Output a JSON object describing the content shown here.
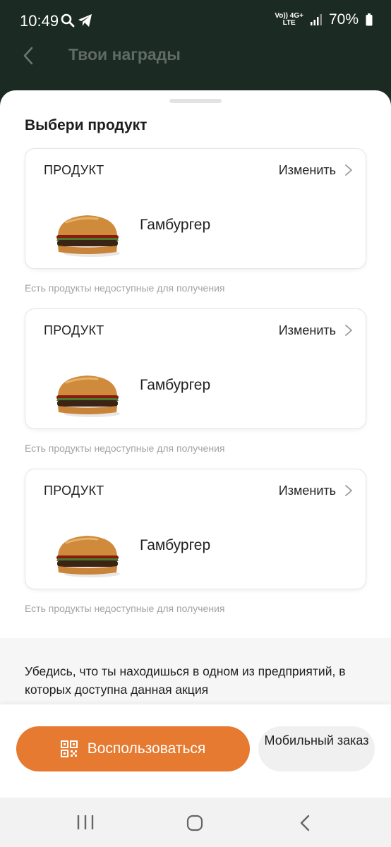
{
  "status_bar": {
    "time": "10:49",
    "net_top": "Vo)) 4G+",
    "net_bottom": "LTE",
    "battery": "70%"
  },
  "nav": {
    "title": "Твои награды"
  },
  "sheet": {
    "heading": "Выбери продукт",
    "cards": [
      {
        "label": "ПРОДУКТ",
        "change": "Изменить",
        "product": "Гамбургер",
        "note": "Есть продукты недоступные для получения"
      },
      {
        "label": "ПРОДУКТ",
        "change": "Изменить",
        "product": "Гамбургер",
        "note": "Есть продукты недоступные для получения"
      },
      {
        "label": "ПРОДУКТ",
        "change": "Изменить",
        "product": "Гамбургер",
        "note": "Есть продукты недоступные для получения"
      }
    ],
    "info": "Убедись, что ты находишься в одном из предприятий, в которых доступна данная акция"
  },
  "actions": {
    "use_label": "Воспользоваться",
    "mobile_label": "Мобильный заказ"
  },
  "colors": {
    "accent": "#e57a30",
    "header": "#1b2a22"
  },
  "icons": [
    "search-icon",
    "telegram-icon",
    "signal-icon",
    "battery-icon",
    "back-arrow-icon",
    "chevron-right-icon",
    "qr-code-icon",
    "recents-icon",
    "home-icon",
    "system-back-icon"
  ]
}
